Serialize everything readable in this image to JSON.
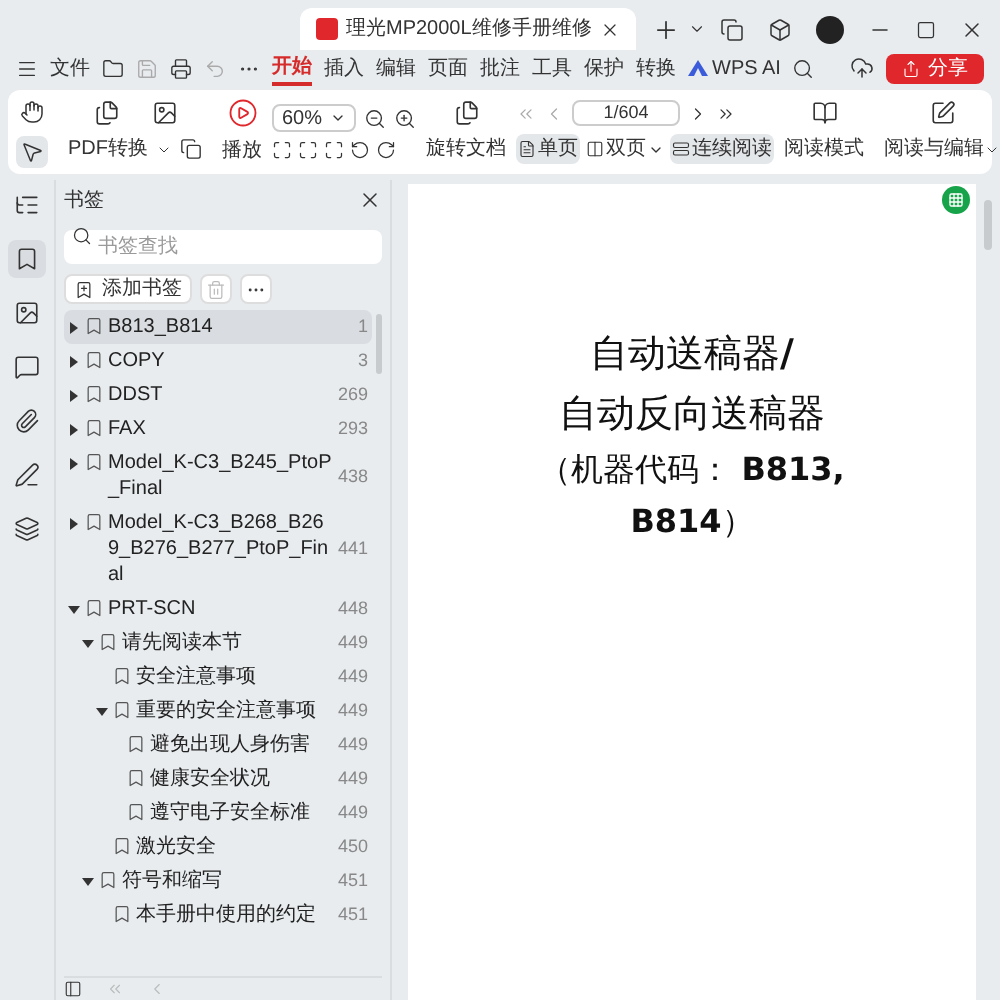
{
  "tab": {
    "title": "理光MP2000L维修手册维修",
    "selected": true
  },
  "menu": {
    "file": "文件",
    "ai": "WPS AI",
    "share": "分享",
    "tabs": [
      {
        "label": "开始",
        "selected": true
      },
      {
        "label": "插入",
        "selected": false
      },
      {
        "label": "编辑",
        "selected": false
      },
      {
        "label": "页面",
        "selected": false
      },
      {
        "label": "批注",
        "selected": false
      },
      {
        "label": "工具",
        "selected": false
      },
      {
        "label": "保护",
        "selected": false
      },
      {
        "label": "转换",
        "selected": false
      }
    ]
  },
  "toolbar": {
    "tools": [
      {
        "kind": "hand",
        "selected": false
      },
      {
        "kind": "select",
        "selected": true
      }
    ],
    "pdf_convert": "PDF转换",
    "play": "播放",
    "zoom": "60%",
    "rotate": "旋转文档",
    "page": "1/604",
    "views": [
      {
        "kind": "single",
        "label": "单页",
        "selected": true,
        "dropdown": false
      },
      {
        "kind": "double",
        "label": "双页",
        "selected": false,
        "dropdown": true
      },
      {
        "kind": "continuous",
        "label": "连续阅读",
        "selected": true,
        "dropdown": false
      }
    ],
    "read_mode": "阅读模式",
    "read_edit": "阅读与编辑"
  },
  "rail": [
    {
      "kind": "outline",
      "selected": false
    },
    {
      "kind": "bookmark",
      "selected": true
    },
    {
      "kind": "image",
      "selected": false
    },
    {
      "kind": "comment",
      "selected": false
    },
    {
      "kind": "attachment",
      "selected": false
    },
    {
      "kind": "sign",
      "selected": false
    },
    {
      "kind": "layers",
      "selected": false
    }
  ],
  "sidebar": {
    "title": "书签",
    "search": {
      "placeholder": "书签查找"
    },
    "add": "添加书签",
    "bookmarks": [
      {
        "title": "B813_B814",
        "page": "1",
        "expanded": false,
        "selected": true
      },
      {
        "title": "COPY",
        "page": "3",
        "expanded": false,
        "selected": false
      },
      {
        "title": "DDST",
        "page": "269",
        "expanded": false,
        "selected": false
      },
      {
        "title": "FAX",
        "page": "293",
        "expanded": false,
        "selected": false
      },
      {
        "title": "Model_K-C3_B245_PtoP_Final",
        "page": "438",
        "expanded": false,
        "selected": false
      },
      {
        "title": "Model_K-C3_B268_B269_B276_B277_PtoP_Final",
        "page": "441",
        "expanded": false,
        "selected": false
      },
      {
        "title": "PRT-SCN",
        "page": "448",
        "expanded": true,
        "selected": false,
        "children": [
          {
            "title": "请先阅读本节",
            "page": "449",
            "expanded": true,
            "selected": false,
            "children": [
              {
                "title": "安全注意事项",
                "page": "449",
                "selected": false
              },
              {
                "title": "重要的安全注意事项",
                "page": "449",
                "expanded": true,
                "selected": false,
                "children": [
                  {
                    "title": "避免出现人身伤害",
                    "page": "449",
                    "selected": false
                  },
                  {
                    "title": "健康安全状况",
                    "page": "449",
                    "selected": false
                  },
                  {
                    "title": "遵守电子安全标准",
                    "page": "449",
                    "selected": false
                  }
                ]
              },
              {
                "title": "激光安全",
                "page": "450",
                "selected": false
              }
            ]
          },
          {
            "title": "符号和缩写",
            "page": "451",
            "expanded": true,
            "selected": false,
            "children": [
              {
                "title": "本手册中使用的约定",
                "page": "451",
                "selected": false
              }
            ]
          }
        ]
      }
    ]
  },
  "document": {
    "lines": [
      "自动送稿器**/**",
      "自动反向送稿器",
      "（机器代码： **B813,**",
      "**B814**）"
    ]
  }
}
